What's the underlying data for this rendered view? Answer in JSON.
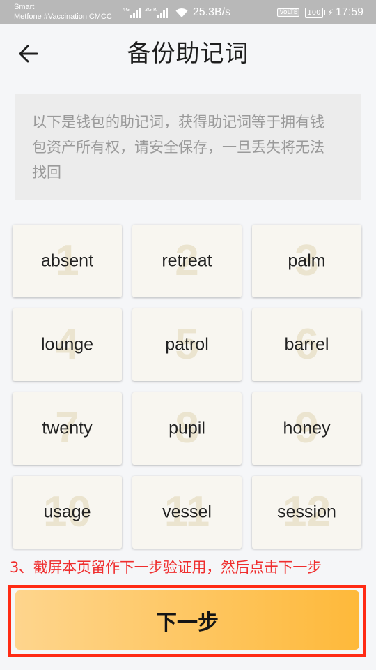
{
  "status_bar": {
    "carrier_line1": "Smart",
    "carrier_line2": "Metfone #Vaccination|CMCC",
    "sim1_tag": "4G",
    "sim2_tag": "3G R",
    "net_speed": "25.3B/s",
    "volte": "VoLTE",
    "battery": "100",
    "time": "17:59",
    "icons": [
      "signal-icon",
      "wifi-icon",
      "battery-icon",
      "charging-icon"
    ]
  },
  "header": {
    "title": "备份助记词",
    "back_icon": "arrow-left-icon"
  },
  "notice": {
    "text": "以下是钱包的助记词，获得助记词等于拥有钱包资产所有权，请安全保存，一旦丢失将无法找回"
  },
  "mnemonic": {
    "words": [
      {
        "n": "1",
        "w": "absent"
      },
      {
        "n": "2",
        "w": "retreat"
      },
      {
        "n": "3",
        "w": "palm"
      },
      {
        "n": "4",
        "w": "lounge"
      },
      {
        "n": "5",
        "w": "patrol"
      },
      {
        "n": "6",
        "w": "barrel"
      },
      {
        "n": "7",
        "w": "twenty"
      },
      {
        "n": "8",
        "w": "pupil"
      },
      {
        "n": "9",
        "w": "honey"
      },
      {
        "n": "10",
        "w": "usage"
      },
      {
        "n": "11",
        "w": "vessel"
      },
      {
        "n": "12",
        "w": "session"
      }
    ]
  },
  "hint": "3、截屏本页留作下一步验证用，然后点击下一步",
  "next_button": "下一步",
  "colors": {
    "accent_start": "#fed58d",
    "accent_end": "#feb93a",
    "highlight": "#ff2b14",
    "hint": "#ef2e2e"
  }
}
